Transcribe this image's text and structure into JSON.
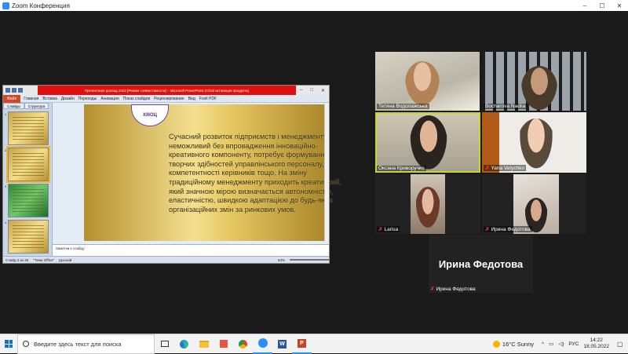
{
  "zoom": {
    "title": "Zoom Конференция",
    "controls": [
      "–",
      "☐",
      "✕"
    ]
  },
  "powerpoint": {
    "title_bar_text": "Презентація доклад 2022 [Режим совместимости] – Microsoft PowerPoint (Сбой активации продукта)",
    "ribbon_file": "Файл",
    "ribbon_tabs": [
      "Главная",
      "Вставка",
      "Дизайн",
      "Переходы",
      "Анимация",
      "Показ слайдов",
      "Рецензирование",
      "Вид",
      "Foxit PDF"
    ],
    "sidebar_tabs": [
      "Слайды",
      "Структура"
    ],
    "slide_numbers": [
      "1",
      "2",
      "3",
      "4"
    ],
    "slide_logo": "ХІІІОЦ",
    "slide_text": "Сучасний розвиток підприємств і менеджменту неможливий без впровадження інноваційно-креативного компоненту, потребує формування творчих здібностей управлінського персоналу, компетентності керівників тощо. На зміну традиційному менеджменту приходить креативний, який значною мірою визначається автономністю, еластичністю, швидкою адаптацією до будь-яких організаційних змін за ринкових умов.",
    "notes_placeholder": "Заметки к слайду",
    "status": {
      "slide": "Слайд 2 из 26",
      "theme": "\"Тема Office\"",
      "language": "русский",
      "zoom": "63%"
    }
  },
  "participants": [
    {
      "name": "Тетяна Водолажська",
      "muted": false
    },
    {
      "name": "Bocharova Nadiia",
      "muted": false
    },
    {
      "name": "Оксана Криворучко",
      "muted": false
    },
    {
      "name": "Yana Velychko",
      "muted": true
    },
    {
      "name": "Larisa",
      "muted": true
    },
    {
      "name": "Ирина Федотова",
      "muted": true
    }
  ],
  "name_only_tile": {
    "label": "Ирина Федотова",
    "name": "Ирина Федотова",
    "muted": true
  },
  "taskbar": {
    "search_placeholder": "Введите здесь текст для поиска",
    "weather": "16°C  Sunny",
    "language": "РУС",
    "time": "14:22",
    "date": "18.05.2022"
  },
  "icon_names": [
    "windows-start-icon",
    "search-icon",
    "task-view-icon",
    "edge-icon",
    "file-explorer-icon",
    "store-icon",
    "chrome-icon",
    "zoom-icon",
    "word-icon",
    "powerpoint-icon",
    "sun-icon"
  ],
  "colors": {
    "ppt_title_red": "#e01010",
    "slide_gold": "#e6c862",
    "active_speaker_border": "#c8d62b",
    "muted_mic": "#e03a3a",
    "zoom_blue": "#2d8cff"
  }
}
